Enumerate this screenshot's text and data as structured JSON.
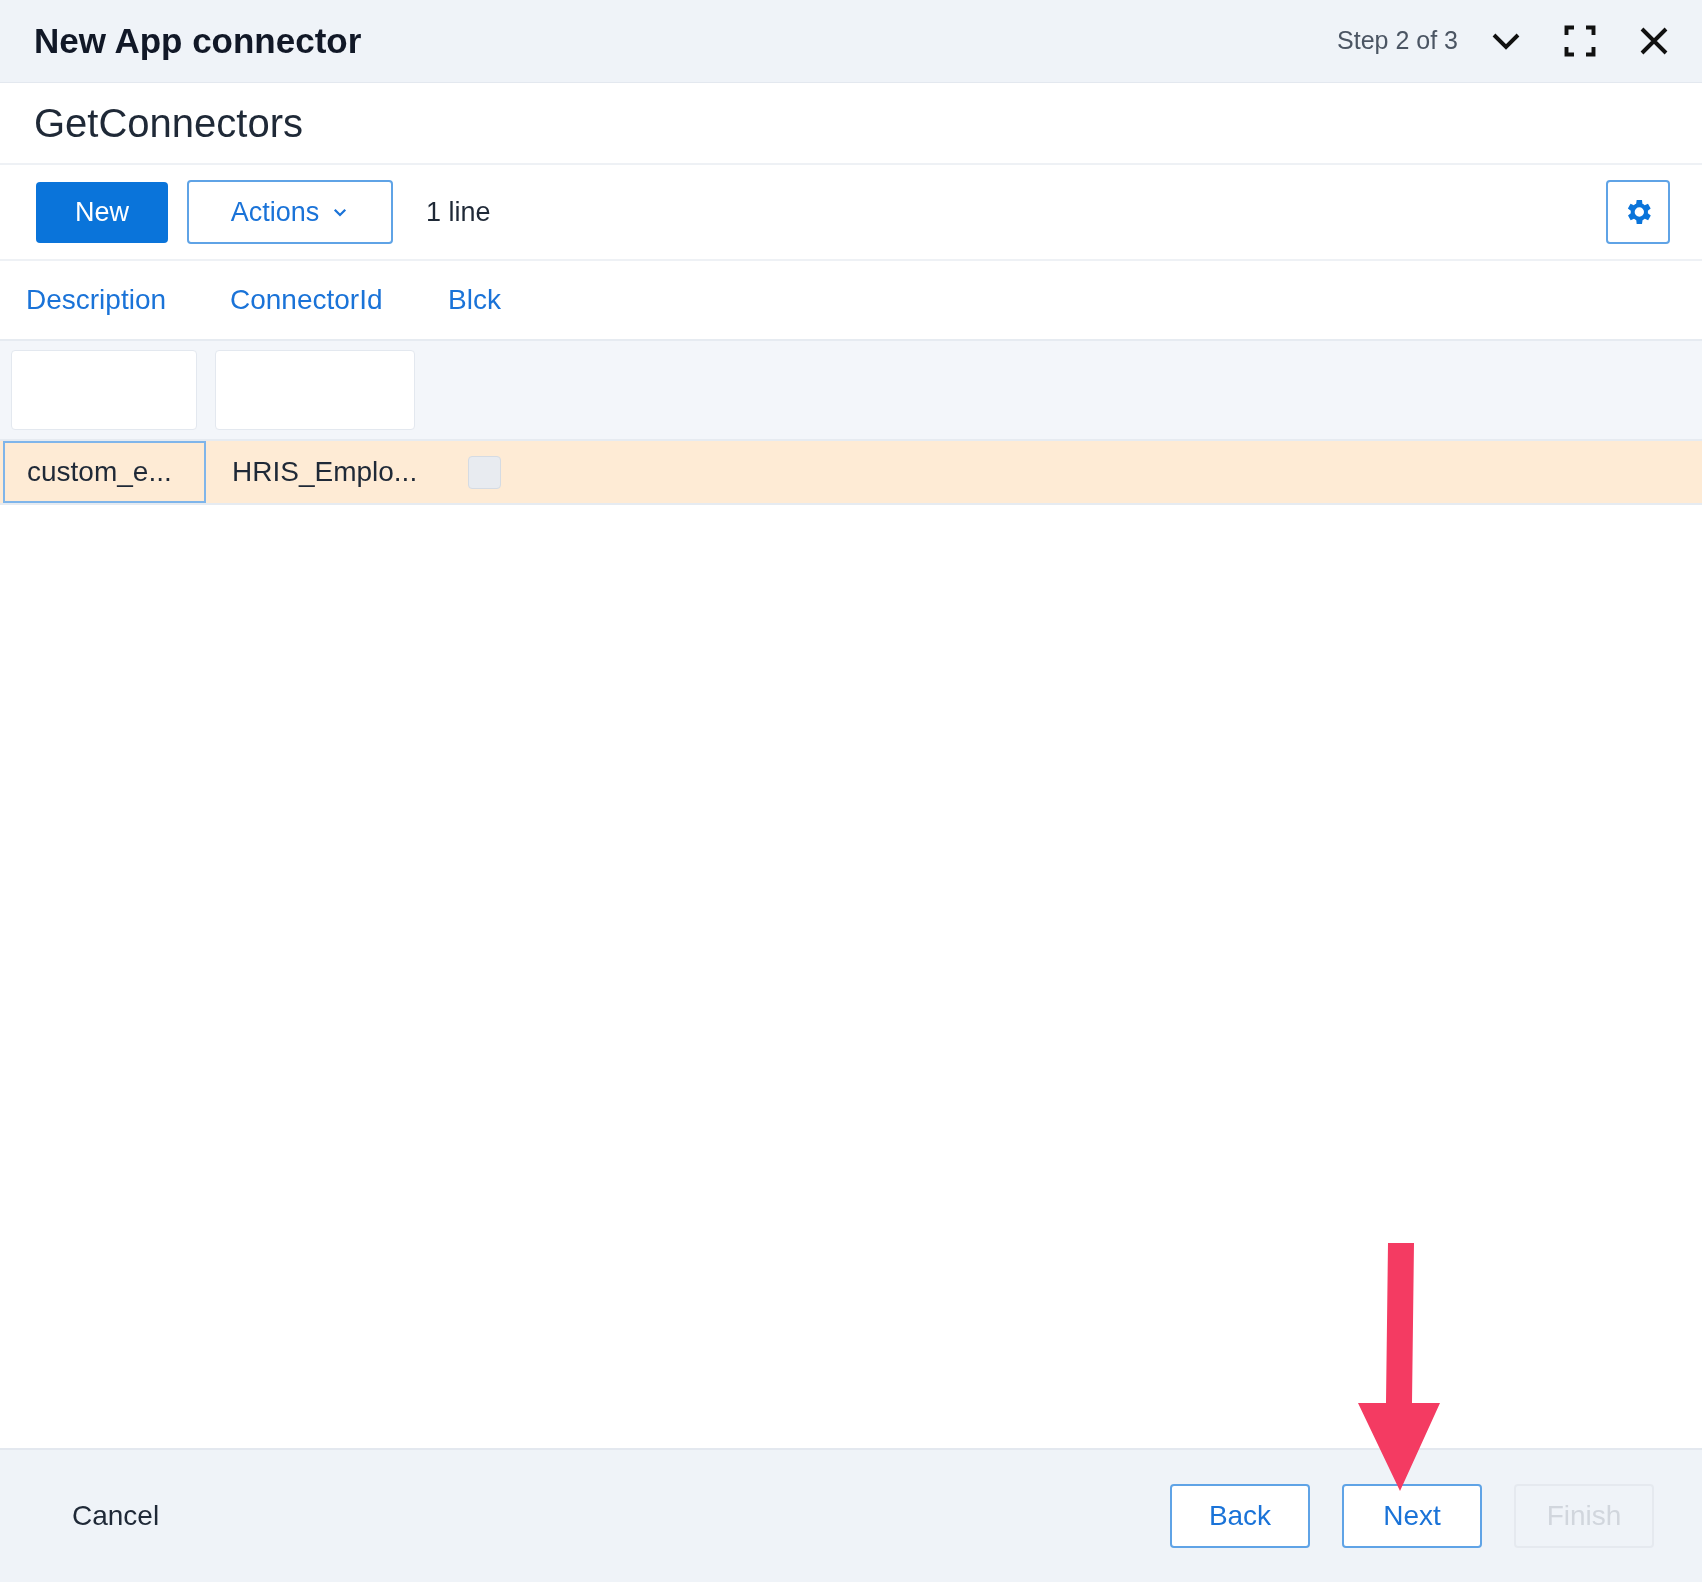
{
  "window": {
    "title": "New App connector",
    "step": "Step 2 of 3"
  },
  "subtitle": "GetConnectors",
  "toolbar": {
    "new_button": "New",
    "actions_button": "Actions",
    "count": "1 line"
  },
  "table": {
    "columns": [
      "Description",
      "ConnectorId",
      "Blck"
    ],
    "rows": [
      {
        "cells": [
          "custom_e...",
          "HRIS_Emplo..."
        ],
        "blocked": false,
        "selected": true
      }
    ]
  },
  "footer": {
    "cancel": "Cancel",
    "buttons": [
      {
        "label": "Back",
        "disabled": false
      },
      {
        "label": "Next",
        "disabled": false
      },
      {
        "label": "Finish",
        "disabled": true
      }
    ]
  }
}
